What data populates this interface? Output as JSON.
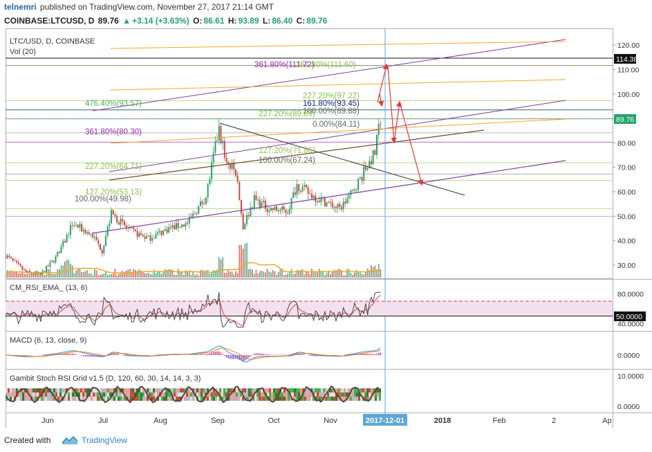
{
  "header": {
    "username": "telnemri",
    "published": "published on TradingView.com, November 27, 2017 21:14 GMT",
    "symbol": "COINBASE:LTCUSD, D",
    "price": "89.76",
    "change": "+3.14 (+3.63%)",
    "open_label": "O:",
    "open": "86.61",
    "high_label": "H:",
    "high": "93.89",
    "low_label": "L:",
    "low": "86.40",
    "close_label": "C:",
    "close": "89.76"
  },
  "main_pane": {
    "symbol_title": "LTC/USD, D, COINBASE",
    "volume_label": "Vol (20)",
    "last_price_tag": "89.76",
    "crosshair_price_tag": "114.38"
  },
  "panes": {
    "rsi_title": "CM_RSI_EMA_ (13, 6)",
    "rsi_tag": "50.0000",
    "macd_title": "MACD (6, 13, close, 9)",
    "stoch_title": "Gambit Stoch RSI Grid v1.5 (D, 120, 60, 30, 14, 14, 3, 3)"
  },
  "time_axis": {
    "labels": [
      "Jun",
      "Jul",
      "Aug",
      "Sep",
      "Oct",
      "Nov",
      "2017-12-01",
      "2018",
      "Feb",
      "2",
      "Ap"
    ],
    "highlighted": "2017-12-01"
  },
  "fib_labels": [
    {
      "text": "361.80%(111.72)",
      "color": "#9c27b0"
    },
    {
      "text": "361.80%(111.60)",
      "color": "#8bc34a"
    },
    {
      "text": "476.40%(93.57)",
      "color": "#4caf50"
    },
    {
      "text": "227.20%(97.22)",
      "color": "#8bc34a"
    },
    {
      "text": "161.80%(93.45)",
      "color": "#1a237e"
    },
    {
      "text": "100.00%(89.88)",
      "color": "#666666"
    },
    {
      "text": "227.20%(89.89)",
      "color": "#8bc34a"
    },
    {
      "text": "0.00%(84.11)",
      "color": "#666666"
    },
    {
      "text": "361.80%(80.30)",
      "color": "#9c27b0"
    },
    {
      "text": "127.20%(71.86)",
      "color": "#8bc34a"
    },
    {
      "text": "100.00%(67.24)",
      "color": "#666666"
    },
    {
      "text": "227.20%(64.71)",
      "color": "#8bc34a"
    },
    {
      "text": "127.20%(53.13)",
      "color": "#8bc34a"
    },
    {
      "text": "100.00%(49.98)",
      "color": "#666666"
    }
  ],
  "chart_data": [
    {
      "type": "candlestick",
      "title": "LTC/USD, D, COINBASE",
      "x_range": [
        "2017-05-09",
        "2018-04-01"
      ],
      "ylim": [
        10,
        125
      ],
      "y_ticks": [
        20,
        30,
        40,
        50,
        60,
        70,
        80,
        90,
        100,
        110,
        120
      ],
      "last_close": 89.76,
      "horizontal_levels": [
        111.72,
        111.6,
        97.22,
        93.57,
        93.45,
        89.89,
        89.88,
        84.11,
        80.3,
        71.86,
        67.24,
        64.71,
        53.13,
        49.98
      ],
      "price_path": [
        {
          "date": "2017-05-09",
          "close": 34
        },
        {
          "date": "2017-05-20",
          "close": 27
        },
        {
          "date": "2017-05-28",
          "close": 26
        },
        {
          "date": "2017-06-05",
          "close": 33
        },
        {
          "date": "2017-06-10",
          "close": 40
        },
        {
          "date": "2017-06-14",
          "close": 47
        },
        {
          "date": "2017-06-25",
          "close": 42
        },
        {
          "date": "2017-06-30",
          "close": 36
        },
        {
          "date": "2017-07-05",
          "close": 51
        },
        {
          "date": "2017-07-15",
          "close": 44
        },
        {
          "date": "2017-07-25",
          "close": 41
        },
        {
          "date": "2017-08-05",
          "close": 45
        },
        {
          "date": "2017-08-15",
          "close": 47
        },
        {
          "date": "2017-08-25",
          "close": 58
        },
        {
          "date": "2017-09-01",
          "close": 86
        },
        {
          "date": "2017-09-05",
          "close": 72
        },
        {
          "date": "2017-09-10",
          "close": 68
        },
        {
          "date": "2017-09-14",
          "close": 46
        },
        {
          "date": "2017-09-20",
          "close": 57
        },
        {
          "date": "2017-09-28",
          "close": 53
        },
        {
          "date": "2017-10-08",
          "close": 52
        },
        {
          "date": "2017-10-13",
          "close": 63
        },
        {
          "date": "2017-10-20",
          "close": 59
        },
        {
          "date": "2017-10-28",
          "close": 56
        },
        {
          "date": "2017-11-05",
          "close": 53
        },
        {
          "date": "2017-11-12",
          "close": 60
        },
        {
          "date": "2017-11-18",
          "close": 68
        },
        {
          "date": "2017-11-24",
          "close": 76
        },
        {
          "date": "2017-11-27",
          "close": 89.76
        }
      ]
    },
    {
      "type": "line",
      "title": "CM_RSI_EMA_ (13, 6)",
      "ylim": [
        30,
        100
      ],
      "y_ticks": [
        40,
        80
      ],
      "levels": [
        50,
        70,
        30
      ]
    },
    {
      "type": "line",
      "title": "MACD (6, 13, close, 9)",
      "y_ticks": [
        0
      ]
    },
    {
      "type": "heatmap",
      "title": "Gambit Stoch RSI Grid v1.5 (D, 120, 60, 30, 14, 14, 3, 3)",
      "y_ticks": [
        0,
        10
      ]
    }
  ],
  "axis_ticks": {
    "main": [
      "120.00",
      "110.00",
      "100.00",
      "90.00",
      "80.00",
      "70.00",
      "60.00",
      "50.00",
      "40.00",
      "30.00",
      "20.00"
    ],
    "rsi": [
      "80.0000",
      "40.0000"
    ],
    "macd": [
      "0.0000"
    ],
    "stoch": [
      "10.0000",
      "0.0000"
    ]
  },
  "colors": {
    "up": "#26a269",
    "down": "#d0463c",
    "purple": "#7b3fa0",
    "orange": "#f5a623",
    "fib_green": "#8bc34a",
    "accent": "#2c85c9"
  },
  "footer": {
    "created": "Created with",
    "brand": "TradingView"
  }
}
